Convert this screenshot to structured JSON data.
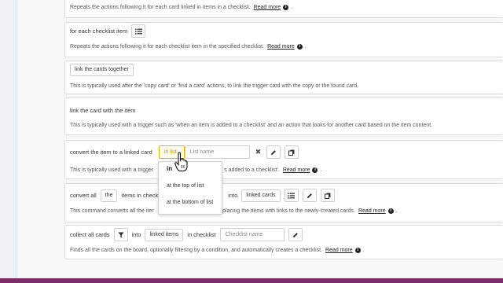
{
  "panels": {
    "p1": {
      "description": "Repeats the actions following it for each card linked in items in a checklist.",
      "read_more": "Read more"
    },
    "p2": {
      "title": "for each checklist item",
      "description": "Repeats the actions following it for each checklist item in the specified checklist.",
      "read_more": "Read more"
    },
    "p3": {
      "button": "link the cards together",
      "description": "This is typically used after the 'copy card' or 'find a card' actions, to link the trigger card with the copy or the found card."
    },
    "p4": {
      "title": "link the card with the item",
      "description": "This is typically used with a trigger such as 'when an item is added to a checklist' and an action that looks for another card based on the item content."
    },
    "p5": {
      "title": "convert the item to a linked card",
      "select_value": "in list",
      "list_placeholder": "List name",
      "clear": "✖",
      "description_start": "This is typically used with a trigger",
      "description_end": "s added to a checklist'.",
      "read_more": "Read more"
    },
    "p6": {
      "convert_label": "convert all",
      "the_select": "the",
      "items_label": "items in checklist",
      "into_label": "into",
      "linked_cards_select": "linked cards",
      "description_start": "This command converts all the iter",
      "description_end": "ds, replacing the items with links to the newly-created cards.",
      "read_more": "Read more"
    },
    "p7": {
      "collect_label": "collect all cards",
      "into_label": "into",
      "linked_items_select": "linked items",
      "in_checklist_label": "in checklist",
      "checklist_placeholder": "Checklist name",
      "description": "Finds all the cards on the board, optionally filtering by a condition, and automatically creates a checklist.",
      "read_more": "Read more"
    }
  },
  "dropdown": {
    "options": [
      "in",
      "at the top of list",
      "at the bottom of list"
    ],
    "selected": "in"
  },
  "icons": {
    "list": "list-icon",
    "edit": "pencil-icon",
    "copy": "copy-icon",
    "filter": "filter-icon",
    "info": "info-icon",
    "cursor": "hand-cursor-icon"
  },
  "colors": {
    "accent_bottom_bar": "#7d2e68",
    "focus_yellow": "#e9b400"
  }
}
